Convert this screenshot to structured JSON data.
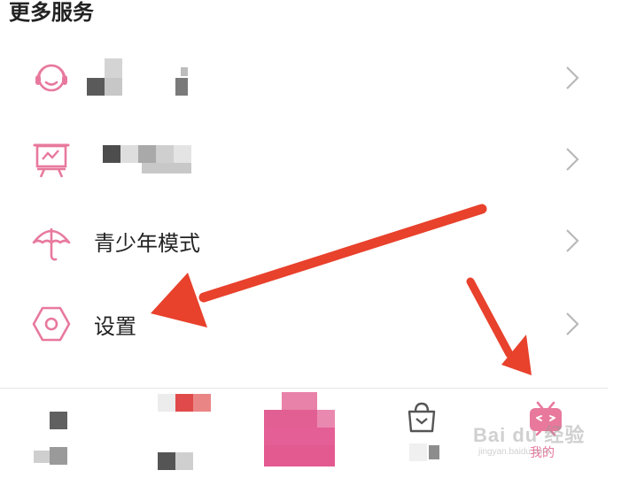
{
  "section": {
    "title": "更多服务"
  },
  "menu": {
    "items": [
      {
        "icon": "headset-icon",
        "label": ""
      },
      {
        "icon": "presentation-icon",
        "label": ""
      },
      {
        "icon": "umbrella-icon",
        "label": "青少年模式"
      },
      {
        "icon": "settings-hexagon-icon",
        "label": "设置"
      }
    ]
  },
  "bottom_nav": {
    "tabs": [
      {
        "icon": "home-icon",
        "label": ""
      },
      {
        "icon": "channel-icon",
        "label": ""
      },
      {
        "icon": "publish-icon",
        "label": ""
      },
      {
        "icon": "shop-bag-icon",
        "label": ""
      },
      {
        "icon": "tv-mine-icon",
        "label": "我的"
      }
    ]
  },
  "watermark": {
    "brand": "Bai du 经验",
    "url": "jingyan.baidu.com"
  },
  "colors": {
    "accent": "#e8799d",
    "arrow": "#e8412c",
    "text": "#222222",
    "chevron": "#b9b9b9",
    "divider": "#e6e6e6"
  }
}
